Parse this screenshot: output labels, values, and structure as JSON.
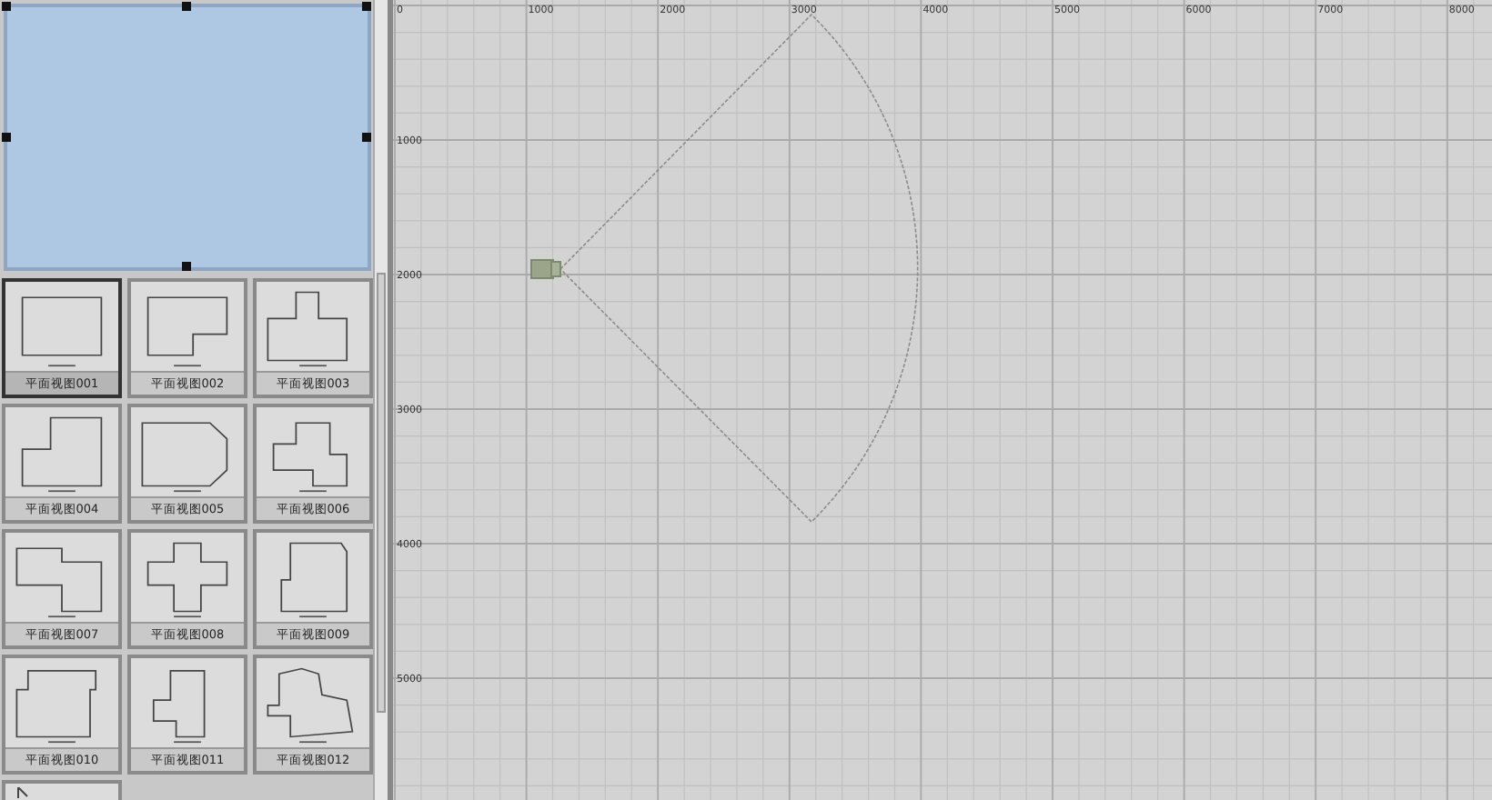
{
  "thumbnails": [
    {
      "label": "平面视图001",
      "selected": true
    },
    {
      "label": "平面视图002",
      "selected": false
    },
    {
      "label": "平面视图003",
      "selected": false
    },
    {
      "label": "平面视图004",
      "selected": false
    },
    {
      "label": "平面视图005",
      "selected": false
    },
    {
      "label": "平面视图006",
      "selected": false
    },
    {
      "label": "平面视图007",
      "selected": false
    },
    {
      "label": "平面视图008",
      "selected": false
    },
    {
      "label": "平面视图009",
      "selected": false
    },
    {
      "label": "平面视图010",
      "selected": false
    },
    {
      "label": "平面视图011",
      "selected": false
    },
    {
      "label": "平面视图012",
      "selected": false
    },
    {
      "selected": false
    }
  ],
  "canvas": {
    "x_ruler": [
      "0",
      "1000",
      "2000",
      "3000",
      "4000",
      "5000",
      "6000",
      "7000",
      "8000"
    ],
    "y_ruler": [
      "1000",
      "2000",
      "3000",
      "4000",
      "5000"
    ]
  }
}
